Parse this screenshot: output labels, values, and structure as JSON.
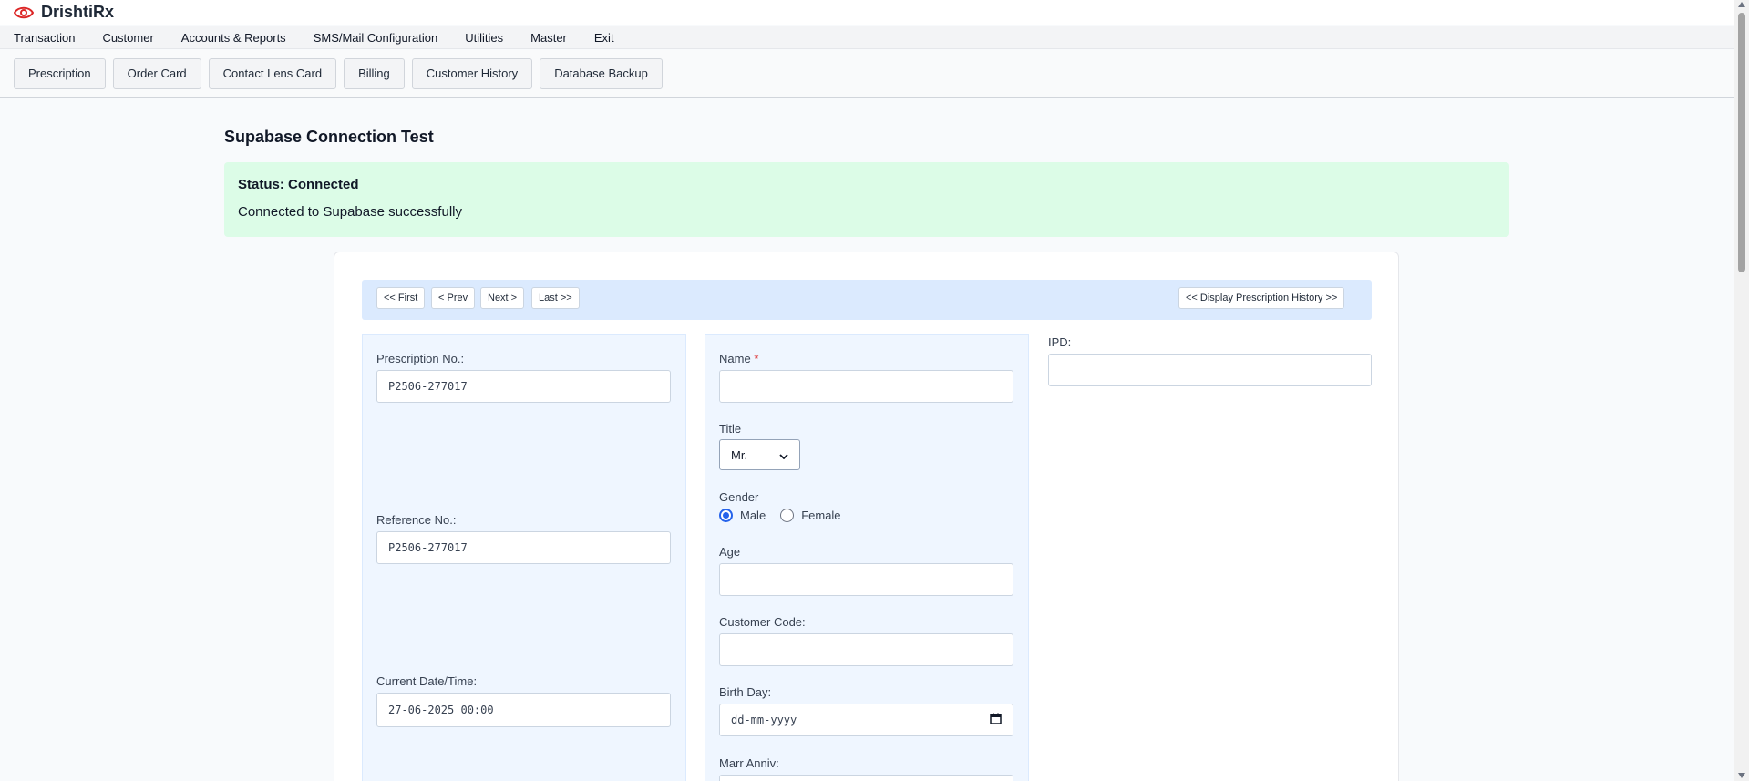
{
  "app": {
    "title": "DrishtiRx",
    "logo_icon": "eye-icon",
    "accent": "#dc2626"
  },
  "menu": [
    "Transaction",
    "Customer",
    "Accounts & Reports",
    "SMS/Mail Configuration",
    "Utilities",
    "Master",
    "Exit"
  ],
  "toolbar": [
    "Prescription",
    "Order Card",
    "Contact Lens Card",
    "Billing",
    "Customer History",
    "Database Backup"
  ],
  "page": {
    "title": "Supabase Connection Test",
    "status_label": "Status: Connected",
    "status_message": "Connected to Supabase successfully",
    "status_color": "#dcfce7"
  },
  "nav": {
    "first": "<< First",
    "prev": "< Prev",
    "next": "Next >",
    "last": "Last >>",
    "history": "<< Display Prescription History >>"
  },
  "left_panel": {
    "prescription_no_label": "Prescription No.:",
    "prescription_no_value": "P2506-277017",
    "reference_no_label": "Reference No.:",
    "reference_no_value": "P2506-277017",
    "datetime_label": "Current Date/Time:",
    "datetime_value": "27-06-2025 00:00"
  },
  "middle_panel": {
    "name_label": "Name",
    "name_required_mark": "*",
    "name_value": "",
    "title_label": "Title",
    "title_selected": "Mr.",
    "gender_label": "Gender",
    "gender_options": [
      "Male",
      "Female"
    ],
    "gender_selected": "Male",
    "age_label": "Age",
    "age_value": "",
    "customer_code_label": "Customer Code:",
    "customer_code_value": "",
    "birthday_label": "Birth Day:",
    "birthday_placeholder": "dd-mm-yyyy",
    "marr_anniv_label": "Marr Anniv:"
  },
  "right_panel": {
    "ipd_label": "IPD:",
    "ipd_value": ""
  }
}
